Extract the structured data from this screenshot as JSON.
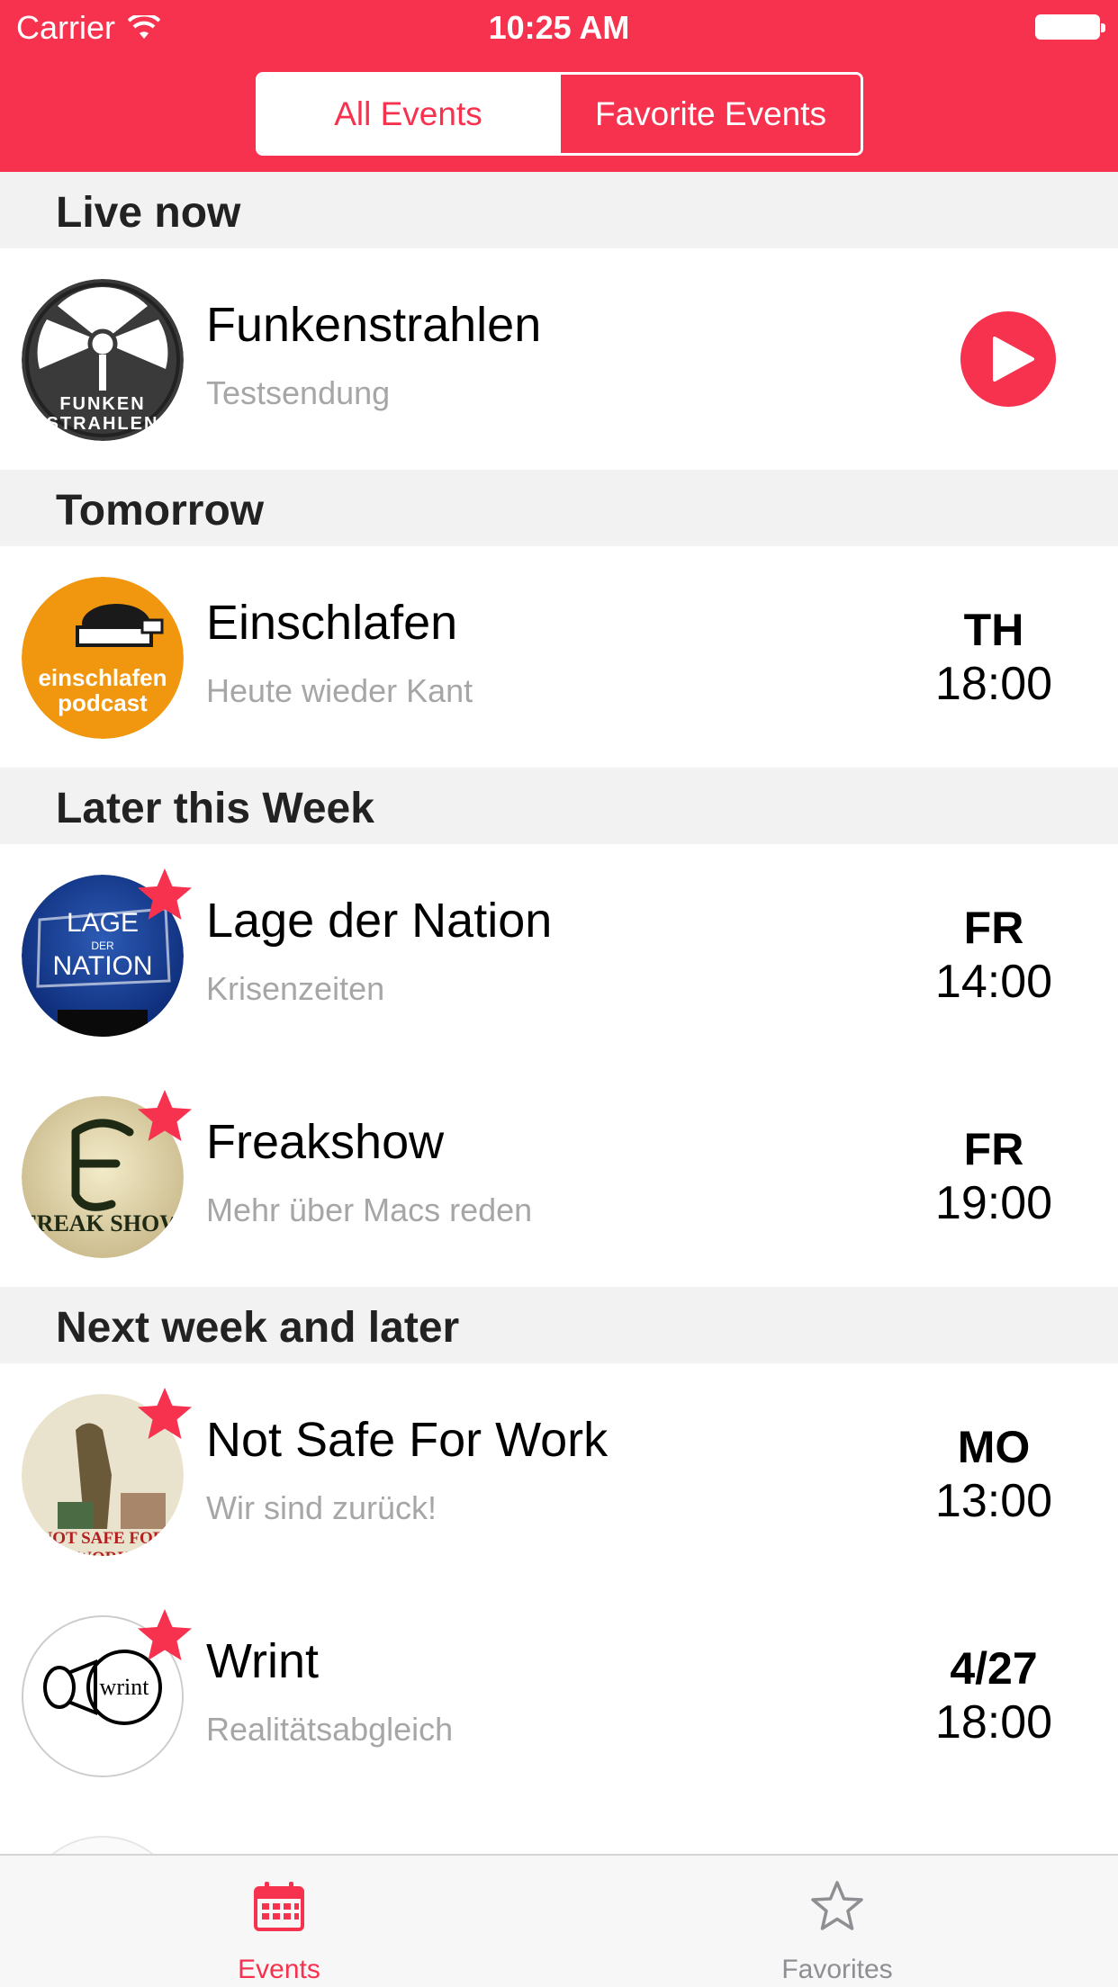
{
  "status_bar": {
    "carrier": "Carrier",
    "time": "10:25 AM"
  },
  "segments": {
    "all": "All Events",
    "favorites": "Favorite Events"
  },
  "sections": [
    {
      "title": "Live now"
    },
    {
      "title": "Tomorrow"
    },
    {
      "title": "Later this Week"
    },
    {
      "title": "Next week and later"
    }
  ],
  "events": [
    {
      "title": "Funkenstrahlen",
      "subtitle": "Testsendung",
      "logo_text": "FUNKEN STRAHLEN",
      "live": true
    },
    {
      "title": "Einschlafen",
      "subtitle": "Heute wieder Kant",
      "day": "TH",
      "time": "18:00",
      "logo_text": "einschlafen podcast"
    },
    {
      "title": "Lage der Nation",
      "subtitle": "Krisenzeiten",
      "day": "FR",
      "time": "14:00",
      "logo_text_1": "LAGE",
      "logo_text_2": "DER",
      "logo_text_3": "NATION",
      "favorite": true
    },
    {
      "title": "Freakshow",
      "subtitle": "Mehr über Macs reden",
      "day": "FR",
      "time": "19:00",
      "logo_text": "FREAK SHOW",
      "favorite": true
    },
    {
      "title": "Not Safe For Work",
      "subtitle": "Wir sind zurück!",
      "day": "MO",
      "time": "13:00",
      "logo_text": "NOT SAFE FOR WORK",
      "favorite": true
    },
    {
      "title": "Wrint",
      "subtitle": "Realitätsabgleich",
      "day": "4/27",
      "time": "18:00",
      "logo_text": "wrint",
      "favorite": true
    }
  ],
  "tabbar": {
    "events": "Events",
    "favorites": "Favorites"
  },
  "colors": {
    "accent": "#f7324f",
    "section_bg": "#f2f2f3",
    "subtitle": "#a6a6a6"
  },
  "icons": {
    "events_tab": "calendar-icon",
    "favorites_tab": "star-outline-icon",
    "favorite_marker": "star-filled-icon",
    "live_action": "play-icon"
  }
}
